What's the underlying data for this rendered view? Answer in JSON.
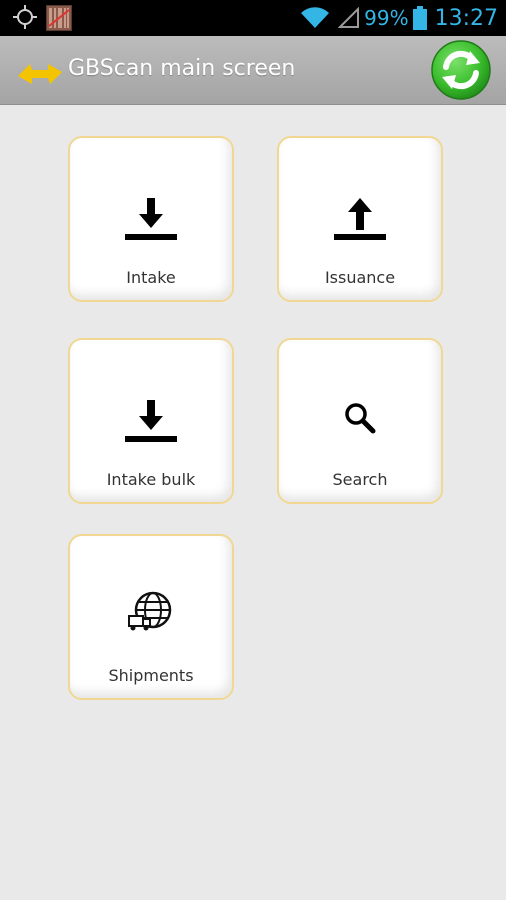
{
  "status_bar": {
    "battery_percent": "99%",
    "time": "13:27",
    "icons": [
      "gps-icon",
      "barcode-notification-icon",
      "wifi-icon",
      "signal-icon",
      "battery-icon"
    ]
  },
  "action_bar": {
    "title": "GBScan main screen",
    "icons": [
      "app-logo-icon",
      "refresh-icon"
    ]
  },
  "menu": {
    "tiles": [
      {
        "label": "Intake",
        "icon": "download-arrow-icon"
      },
      {
        "label": "Issuance",
        "icon": "upload-arrow-icon"
      },
      {
        "label": "Intake bulk",
        "icon": "download-arrow-icon"
      },
      {
        "label": "Search",
        "icon": "search-icon"
      },
      {
        "label": "Shipments",
        "icon": "globe-truck-icon"
      }
    ]
  },
  "colors": {
    "background": "#e9e9e9",
    "status_icons": "#33b5e5",
    "tile_border": "#f0d894",
    "refresh_green": "#3cbf2e",
    "logo_yellow": "#f5c400"
  }
}
